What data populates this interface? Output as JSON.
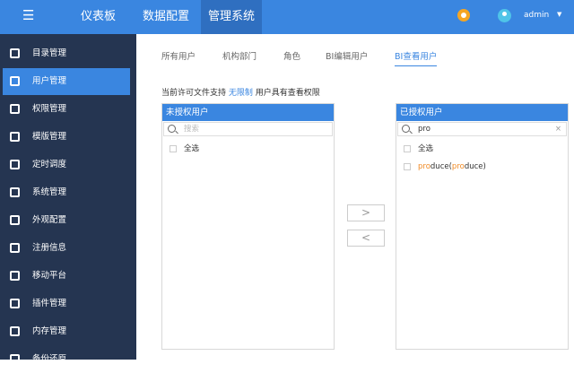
{
  "header": {
    "nav": [
      "仪表板",
      "数据配置",
      "管理系统"
    ],
    "active_nav": "管理系统",
    "user": "admin"
  },
  "sidebar": {
    "items": [
      "目录管理",
      "用户管理",
      "权限管理",
      "模版管理",
      "定时调度",
      "系统管理",
      "外观配置",
      "注册信息",
      "移动平台",
      "插件管理",
      "内存管理",
      "备份还原"
    ],
    "active": "用户管理"
  },
  "tabs": [
    "所有用户",
    "机构部门",
    "角色",
    "BI编辑用户",
    "BI查看用户"
  ],
  "notice": {
    "prefix": "当前许可文件支持",
    "highlight": "无限制",
    "suffix": "用户具有查看权限"
  },
  "left_panel": {
    "title": "未授权用户",
    "search_placeholder": "搜索",
    "select_all": "全选"
  },
  "right_panel": {
    "title": "已授权用户",
    "search_value": "pro",
    "clear": "×",
    "select_all": "全选",
    "items": [
      {
        "match1": "pro",
        "rest1": "duce(",
        "match2": "pro",
        "rest2": "duce)"
      }
    ]
  },
  "buttons": {
    "add": ">",
    "remove": "<"
  },
  "colors": {
    "primary": "#3a86e0",
    "sidebar": "#253551",
    "highlight": "#f08a24"
  }
}
